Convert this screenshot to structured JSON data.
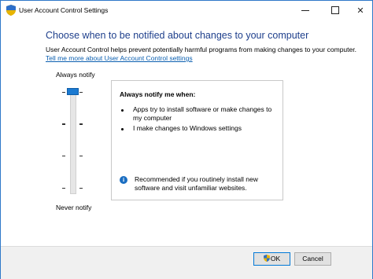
{
  "window": {
    "title": "User Account Control Settings"
  },
  "main": {
    "heading": "Choose when to be notified about changes to your computer",
    "description": "User Account Control helps prevent potentially harmful programs from making changes to your computer.",
    "link": "Tell me more about User Account Control settings"
  },
  "slider": {
    "top_label": "Always notify",
    "bottom_label": "Never notify",
    "levels": 4,
    "selected_level": 4
  },
  "panel": {
    "title": "Always notify me when:",
    "bullets": [
      "Apps try to install software or make changes to my computer",
      "I make changes to Windows settings"
    ],
    "recommendation": "Recommended if you routinely install new software and visit unfamiliar websites."
  },
  "buttons": {
    "ok": "OK",
    "cancel": "Cancel"
  },
  "colors": {
    "heading": "#1e3f8c",
    "link": "#0b5fb0",
    "accent": "#1b7ad1"
  }
}
